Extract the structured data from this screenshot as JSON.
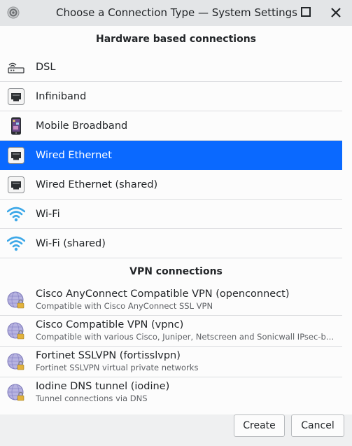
{
  "window": {
    "title": "Choose a Connection Type — System Settings",
    "icons": {
      "app": "gear-app-icon",
      "maximize": "maximize-icon",
      "close": "close-icon"
    }
  },
  "hardware": {
    "header": "Hardware based connections",
    "items": [
      {
        "label": "DSL",
        "icon": "dsl-modem-icon"
      },
      {
        "label": "Infiniband",
        "icon": "network-port-icon"
      },
      {
        "label": "Mobile Broadband",
        "icon": "mobile-phone-icon"
      },
      {
        "label": "Wired Ethernet",
        "icon": "network-port-icon",
        "selected": true
      },
      {
        "label": "Wired Ethernet (shared)",
        "icon": "network-port-icon"
      },
      {
        "label": "Wi-Fi",
        "icon": "wifi-icon"
      },
      {
        "label": "Wi-Fi (shared)",
        "icon": "wifi-icon"
      }
    ]
  },
  "vpn": {
    "header": "VPN connections",
    "items": [
      {
        "label": "Cisco AnyConnect Compatible VPN (openconnect)",
        "description": "Compatible with Cisco AnyConnect SSL VPN",
        "icon": "vpn-globe-lock-icon"
      },
      {
        "label": "Cisco Compatible VPN (vpnc)",
        "description": "Compatible with various Cisco, Juniper, Netscreen and Sonicwall IPsec-ba...",
        "icon": "vpn-globe-lock-icon"
      },
      {
        "label": "Fortinet SSLVPN (fortisslvpn)",
        "description": "Fortinet SSLVPN virtual private networks",
        "icon": "vpn-globe-lock-icon"
      },
      {
        "label": "Iodine DNS tunnel (iodine)",
        "description": "Tunnel connections via DNS",
        "icon": "vpn-globe-lock-icon"
      }
    ]
  },
  "buttons": {
    "create": "Create",
    "cancel": "Cancel"
  },
  "colors": {
    "selection": "#0a69ff",
    "background": "#eff0f1",
    "panel": "#fcfcfc"
  }
}
